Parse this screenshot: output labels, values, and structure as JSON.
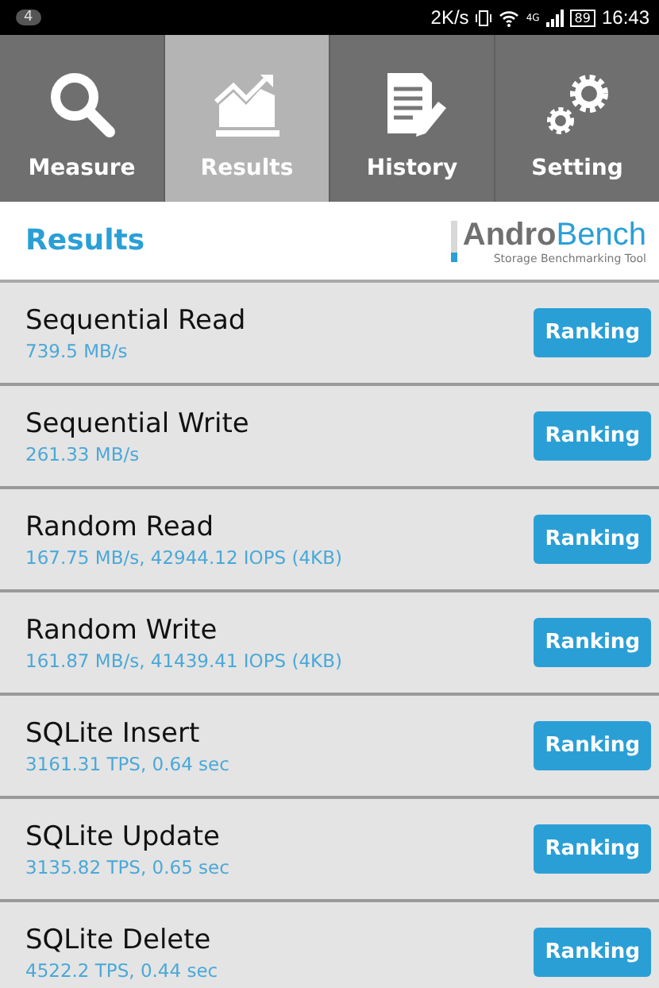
{
  "status_bar": {
    "notifications": "4",
    "speed": "2K/s",
    "network": "4G",
    "battery": "89",
    "time": "16:43"
  },
  "tabs": [
    {
      "label": "Measure",
      "kind": "search",
      "selected": false
    },
    {
      "label": "Results",
      "kind": "chart",
      "selected": true
    },
    {
      "label": "History",
      "kind": "document",
      "selected": false
    },
    {
      "label": "Setting",
      "kind": "gears",
      "selected": false
    }
  ],
  "header": {
    "title": "Results",
    "logo": "**Andro**Bench",
    "tagline": "Storage Benchmarking Tool"
  },
  "results": [
    {
      "name": "Sequential Read",
      "value": "739.5 MB/s",
      "button": "Ranking"
    },
    {
      "name": "Sequential Write",
      "value": "261.33 MB/s",
      "button": "Ranking"
    },
    {
      "name": "Random Read",
      "value": "167.75 MB/s, 42944.12 IOPS (4KB)",
      "button": "Ranking"
    },
    {
      "name": "Random Write",
      "value": "161.87 MB/s, 41439.41 IOPS (4KB)",
      "button": "Ranking"
    },
    {
      "name": "SQLite Insert",
      "value": "3161.31 TPS, 0.64 sec",
      "button": "Ranking"
    },
    {
      "name": "SQLite Update",
      "value": "3135.82 TPS, 0.65 sec",
      "button": "Ranking"
    },
    {
      "name": "SQLite Delete",
      "value": "4522.2 TPS, 0.44 sec",
      "button": "Ranking"
    }
  ]
}
